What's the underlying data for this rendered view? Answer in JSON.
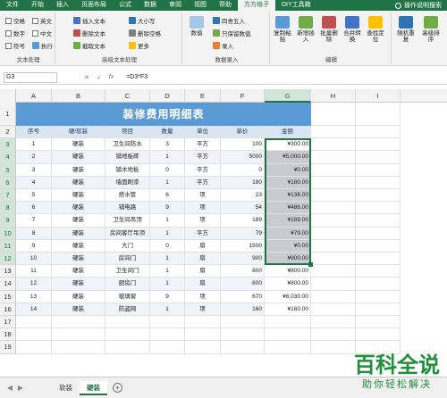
{
  "ribbon_tabs": [
    "文件",
    "开始",
    "插入",
    "页面布局",
    "公式",
    "数据",
    "审阅",
    "视图",
    "帮助",
    "方方格子",
    "DIY工具箱",
    "操作说明搜索"
  ],
  "active_tab": "方方格子",
  "groups": {
    "text": {
      "title": "文本处理",
      "items": [
        "空格",
        "英文",
        "数字",
        "中文",
        "符号",
        "执行"
      ]
    },
    "adv_text": {
      "title": "高级文本处理",
      "items": [
        "插入文本",
        "删除文本",
        "截取文本",
        "大小写",
        "删除空格",
        "更多"
      ]
    },
    "data_entry": {
      "title": "数据录入",
      "items": [
        "数值",
        "四舍五入",
        "只保留数值",
        "录入"
      ]
    },
    "edit": {
      "title": "编辑",
      "items": [
        "复制粘贴",
        "新增插入",
        "批量删除",
        "合并转换",
        "查找定位"
      ]
    },
    "misc": {
      "items": [
        "随机重复",
        "高级排序"
      ]
    }
  },
  "namebox": "G3",
  "formula": "=D3*F3",
  "columns": [
    "A",
    "B",
    "C",
    "D",
    "E",
    "F",
    "G",
    "H",
    "I"
  ],
  "table_title": "装修费用明细表",
  "headers": [
    "序号",
    "硬/软装",
    "项目",
    "数量",
    "单位",
    "单价",
    "金额"
  ],
  "rows": [
    [
      "1",
      "硬装",
      "卫生间防水",
      "3",
      "平方",
      "100",
      "¥300.00"
    ],
    [
      "2",
      "硬装",
      "铺地板砖",
      "1",
      "平方",
      "5000",
      "¥5,000.00"
    ],
    [
      "3",
      "硬装",
      "铺木地板",
      "0",
      "平方",
      "0",
      "¥0.00"
    ],
    [
      "4",
      "硬装",
      "墙面刷漆",
      "1",
      "平方",
      "180",
      "¥180.00"
    ],
    [
      "5",
      "硬装",
      "搭水管",
      "6",
      "项",
      "23",
      "¥138.00"
    ],
    [
      "6",
      "硬装",
      "铺电路",
      "9",
      "项",
      "54",
      "¥486.00"
    ],
    [
      "7",
      "硬装",
      "卫生间吊顶",
      "1",
      "项",
      "189",
      "¥189.00"
    ],
    [
      "8",
      "硬装",
      "房间客厅吊顶",
      "1",
      "平方",
      "79",
      "¥79.00"
    ],
    [
      "9",
      "硬装",
      "大门",
      "0",
      "扇",
      "1500",
      "¥0.00"
    ],
    [
      "10",
      "硬装",
      "房间门",
      "1",
      "扇",
      "900",
      "¥900.00"
    ],
    [
      "11",
      "硬装",
      "卫生间门",
      "1",
      "扇",
      "800",
      "¥800.00"
    ],
    [
      "12",
      "硬装",
      "厨房门",
      "1",
      "扇",
      "800",
      "¥800.00"
    ],
    [
      "13",
      "硬装",
      "玻璃窗",
      "9",
      "项",
      "670",
      "¥6,030.00"
    ],
    [
      "14",
      "硬装",
      "防盗网",
      "1",
      "项",
      "160",
      "¥160.00"
    ]
  ],
  "sheets": [
    "软装",
    "硬装"
  ],
  "active_sheet": "硬装",
  "watermark": {
    "main": "百科全说",
    "sub": "助你轻松解决"
  }
}
